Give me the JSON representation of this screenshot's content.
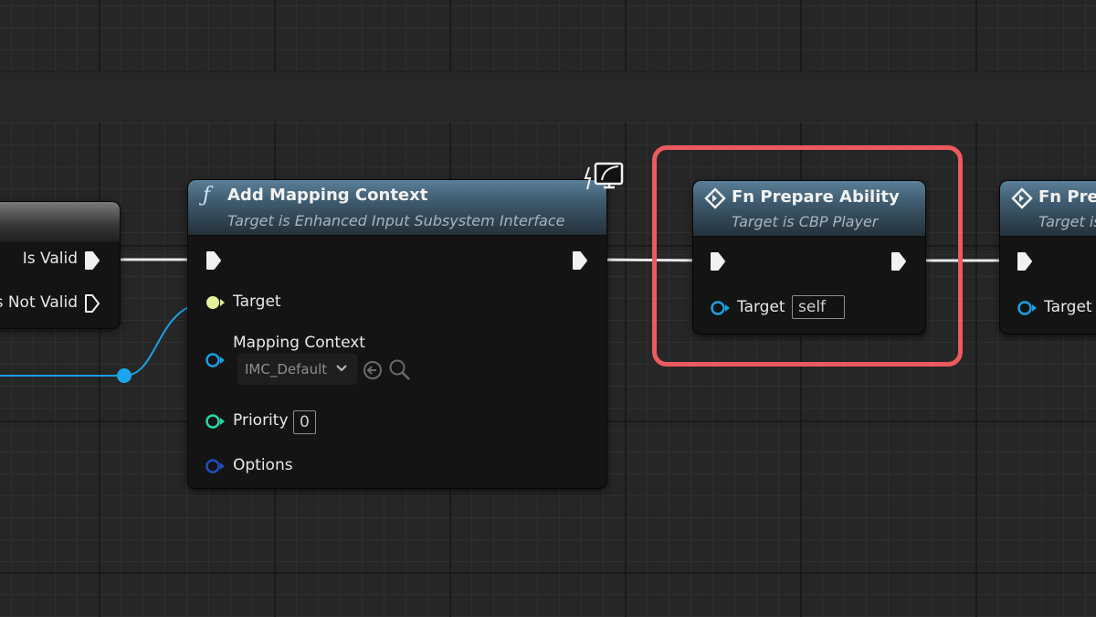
{
  "graph": {
    "left_node": {
      "pins": {
        "is_valid": "Is Valid",
        "is_not_valid": "s Not Valid"
      }
    },
    "add_mapping_node": {
      "title": "Add Mapping Context",
      "subtitle": "Target is Enhanced Input Subsystem Interface",
      "icon": "function-icon",
      "pins": {
        "target": "Target",
        "mapping_context": "Mapping Context",
        "mapping_context_value": "IMC_Default",
        "priority": "Priority",
        "priority_value": "0",
        "options": "Options"
      }
    },
    "prepare_node": {
      "title": "Fn Prepare Ability",
      "subtitle": "Target is CBP Player",
      "icon": "event-diamond-icon",
      "pins": {
        "target": "Target",
        "target_value": "self"
      }
    },
    "right_node": {
      "title": "Fn Prep",
      "subtitle": "Target is",
      "pins": {
        "target": "Target"
      }
    }
  },
  "colors": {
    "highlight": "#ec5a5f",
    "object_pin": "#1a9fe0",
    "interface_pin": "#e4f29a",
    "int_pin": "#27d8a8",
    "struct_pin": "#1f4fbf",
    "header": "#4a6b82"
  }
}
